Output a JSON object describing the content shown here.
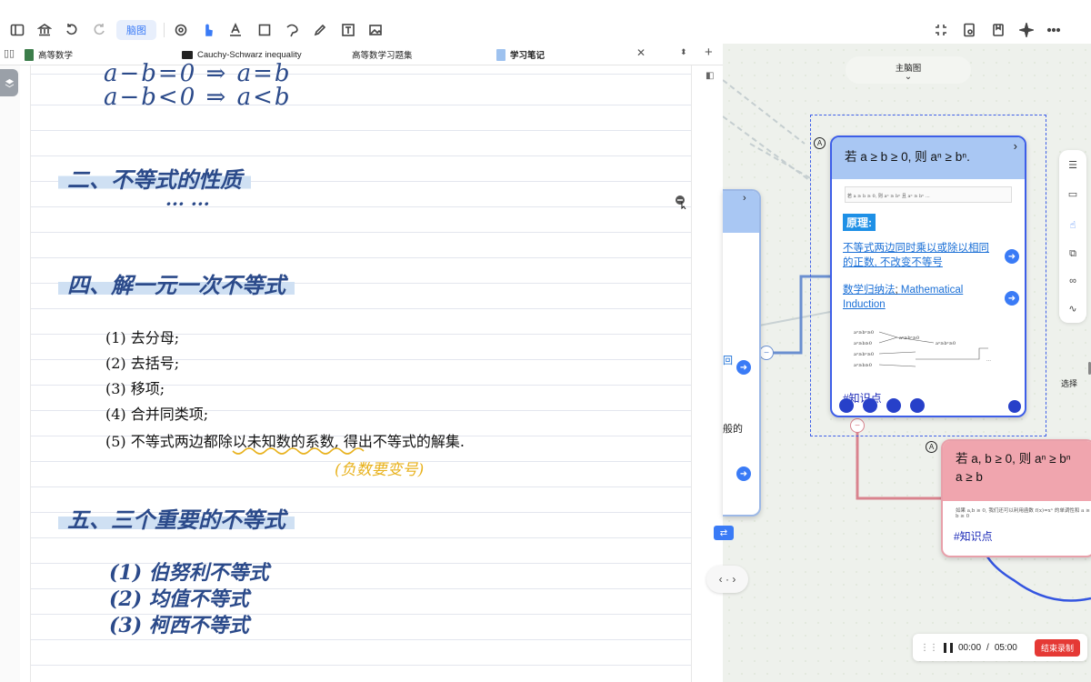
{
  "toolbar": {
    "map_label": "脑图"
  },
  "tabs": [
    {
      "label": "高等数学"
    },
    {
      "label": "Cauchy-Schwarz inequality"
    },
    {
      "label": "高等数学习题集"
    },
    {
      "label": "学习笔记"
    }
  ],
  "notebook": {
    "math_line1": "a−b=0  ⇒  a=b",
    "math_line2": "a−b<0  ⇒  a<b",
    "heading2": "二、不等式的性质",
    "ellipsis": "···  ···",
    "heading4": "四、解一元一次不等式",
    "steps": [
      "(1) 去分母;",
      "(2) 去括号;",
      "(3) 移项;",
      "(4) 合并同类项;",
      "(5) 不等式两边都除以未知数的系数, 得出不等式的解集."
    ],
    "note_neg": "(负数要变号)",
    "heading5": "五、三个重要的不等式",
    "ineq": [
      "(1) 伯努利不等式",
      "(2) 均值不等式",
      "(3) 柯西不等式"
    ]
  },
  "mindmap": {
    "title": "主脑图",
    "main_card": {
      "title": "若 a ≥ b ≥ 0, 则 aⁿ ≥ bⁿ.",
      "principle": "原理:",
      "link1": "不等式两边同时乘以或除以相同的正数, 不改变不等号",
      "link2a": "数学归纳法",
      "link2b": "Mathematical Induction",
      "tag": "#知识点",
      "thumb_text": "若 a ≥ b ≥ 0, 则 aⁿ ≥ bⁿ 且 aⁿ ≥ bⁿ ..."
    },
    "pink_card": {
      "title_l1": "若 a, b ≥ 0, 则 aⁿ ≥ bⁿ",
      "title_l2": "a ≥ b",
      "tag": "#知识点",
      "body": "如果 a,b ≥ 0, 我们还可以利用函数 f(x)=xⁿ 的单调性和 a ≥ b ≥ 0"
    },
    "frag_hui": "回",
    "frag_bande": "般的",
    "select_label": "选择"
  },
  "recorder": {
    "time": "00:00",
    "sep": "/",
    "total": "05:00",
    "stop_label": "结束录制"
  }
}
